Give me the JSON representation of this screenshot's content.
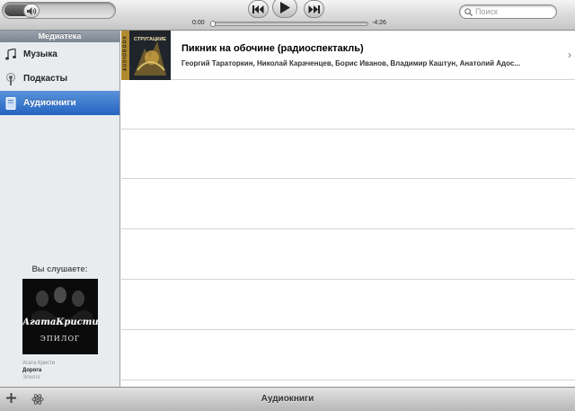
{
  "toolbar": {
    "time_elapsed": "0:00",
    "time_remaining": "-4:26",
    "search_placeholder": "Поиск",
    "volume_level": 0.2,
    "progress": 0.0
  },
  "sidebar": {
    "header": "Медиатека",
    "items": [
      {
        "label": "Музыка",
        "icon": "music-note-icon",
        "selected": false
      },
      {
        "label": "Подкасты",
        "icon": "podcast-icon",
        "selected": false
      },
      {
        "label": "Аудиокниги",
        "icon": "audiobook-icon",
        "selected": true
      }
    ],
    "now_playing": {
      "title": "Вы слушаете:",
      "artist": "Агата Кристи",
      "song": "Дорога",
      "album": "Эпилог",
      "art_text_top": "АгатаКристи",
      "art_text_bottom": "ЭПИЛОГ"
    }
  },
  "list": {
    "items": [
      {
        "title": "Пикник на обочине (радиоспектакль)",
        "authors": "Георгий Тараторкин, Николай Караченцев, Борис Иванов, Владимир Каштун, Анатолий Адос...",
        "art_label_side": "AUDIOBOOK",
        "art_label_top": "СТРУГАЦКИЕ"
      }
    ]
  },
  "bottombar": {
    "title": "Аудиокниги"
  },
  "colors": {
    "selection": "#2f6fcb",
    "sidebar_bg": "#e9ecef",
    "toolbar_top": "#f4f4f4",
    "toolbar_bottom": "#c6c6c6"
  }
}
